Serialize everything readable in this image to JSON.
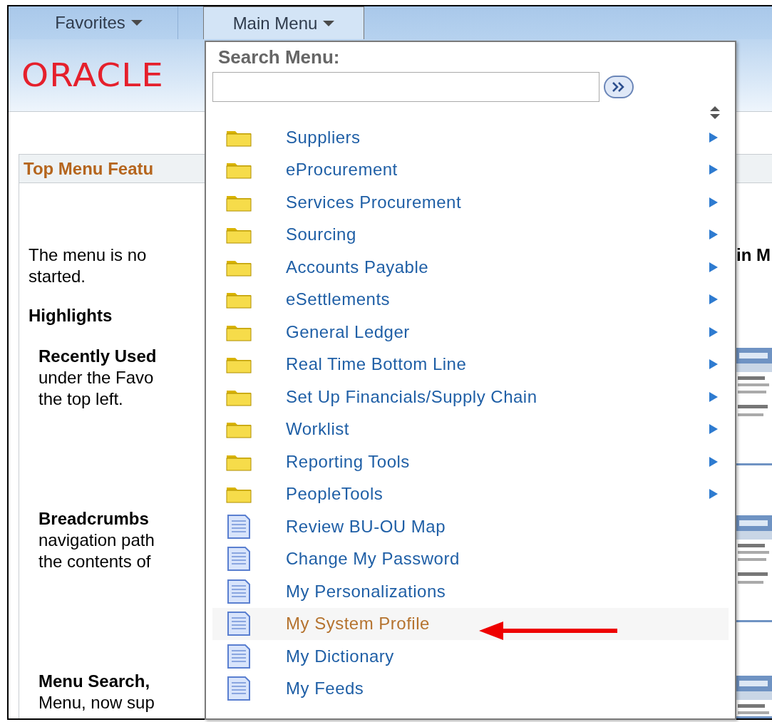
{
  "nav": {
    "tabs": [
      {
        "label": "Favorites",
        "selected": false
      },
      {
        "label": "Main Menu",
        "selected": true
      }
    ]
  },
  "header": {
    "logo": "ORACLE"
  },
  "panel": {
    "title": "Top Menu Featu",
    "intro": [
      "The menu is no",
      "started."
    ],
    "heading": "Highlights",
    "sections": [
      {
        "title": "Recently Used",
        "lines": [
          "under the Favo",
          "the top left."
        ]
      },
      {
        "title": "Breadcrumbs",
        "lines": [
          "navigation path",
          "the contents of"
        ]
      },
      {
        "title": "Menu Search,",
        "lines": [
          "Menu, now sup"
        ]
      }
    ],
    "right_text": "in M",
    "thumbnails": [
      {
        "kind": "picture"
      },
      {
        "kind": "picture"
      },
      {
        "kind": "picture"
      }
    ]
  },
  "menu": {
    "search_label": "Search Menu:",
    "items": [
      {
        "label": "Suppliers",
        "kind": "folder",
        "selected": false
      },
      {
        "label": "eProcurement",
        "kind": "folder",
        "selected": false
      },
      {
        "label": "Services Procurement",
        "kind": "folder",
        "selected": false
      },
      {
        "label": "Sourcing",
        "kind": "folder",
        "selected": false
      },
      {
        "label": "Accounts Payable",
        "kind": "folder",
        "selected": false
      },
      {
        "label": "eSettlements",
        "kind": "folder",
        "selected": false
      },
      {
        "label": "General Ledger",
        "kind": "folder",
        "selected": false
      },
      {
        "label": "Real Time Bottom Line",
        "kind": "folder",
        "selected": false
      },
      {
        "label": "Set Up Financials/Supply Chain",
        "kind": "folder",
        "selected": false
      },
      {
        "label": "Worklist",
        "kind": "folder",
        "selected": false
      },
      {
        "label": "Reporting Tools",
        "kind": "folder",
        "selected": false
      },
      {
        "label": "PeopleTools",
        "kind": "folder",
        "selected": false
      },
      {
        "label": "Review BU-OU Map",
        "kind": "page",
        "selected": false
      },
      {
        "label": "Change My Password",
        "kind": "page",
        "selected": false
      },
      {
        "label": "My Personalizations",
        "kind": "page",
        "selected": false
      },
      {
        "label": "My System Profile",
        "kind": "page",
        "selected": true
      },
      {
        "label": "My Dictionary",
        "kind": "page",
        "selected": false
      },
      {
        "label": "My Feeds",
        "kind": "page",
        "selected": false
      }
    ]
  }
}
